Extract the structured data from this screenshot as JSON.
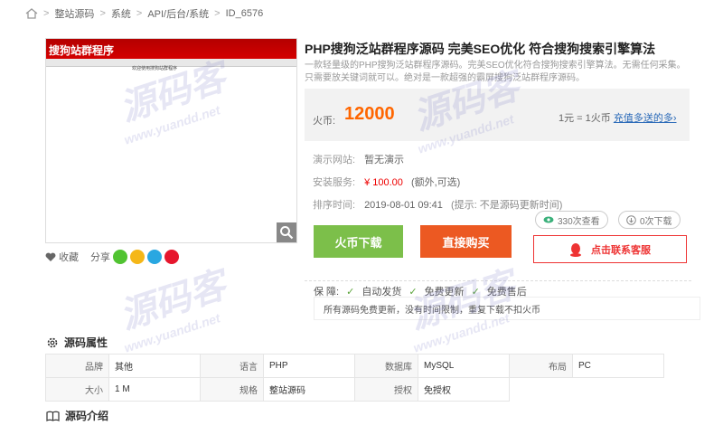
{
  "breadcrumb": {
    "items": [
      "整站源码",
      "系统",
      "API/后台/系统",
      "ID_6576"
    ],
    "sep": ">"
  },
  "preview": {
    "header_text": "搜狗站群程序",
    "mini_text": "欢迎使用搜狗站群程序"
  },
  "actions": {
    "favorite": "收藏",
    "share": "分享"
  },
  "product": {
    "title": "PHP搜狗泛站群程序源码 完美SEO优化 符合搜狗搜索引擎算法",
    "description": "一款轻量级的PHP搜狗泛站群程序源码。完美SEO优化符合搜狗搜索引擎算法。无需任何采集。只需要放关键词就可以。绝对是一款超强的霸屏搜狗泛站群程序源码。"
  },
  "price": {
    "label": "火币:",
    "value": "12000",
    "rate_text": "1元 = 1火币",
    "rate_link": "充值多送的多›"
  },
  "info": {
    "demo_label": "演示网站:",
    "demo_value": "暂无演示",
    "install_label": "安装服务:",
    "install_price": "¥ 100.00",
    "install_note": "(额外,可选)",
    "sort_label": "排序时间:",
    "sort_value": "2019-08-01 09:41",
    "sort_note": "(提示: 不是源码更新时间)",
    "views": "330次查看",
    "downloads": "0次下载"
  },
  "buttons": {
    "download": "火币下载",
    "buy": "直接购买",
    "contact": "点击联系客服"
  },
  "guarantee": {
    "label": "保  障:",
    "items": [
      "自动发货",
      "免费更新",
      "免费售后"
    ],
    "note": "所有源码免费更新，没有时间限制，重复下载不扣火币"
  },
  "attributes": {
    "title": "源码属性",
    "row1": [
      {
        "k": "品牌",
        "v": "其他"
      },
      {
        "k": "语言",
        "v": "PHP"
      },
      {
        "k": "数据库",
        "v": "MySQL"
      },
      {
        "k": "布局",
        "v": "PC"
      }
    ],
    "row2": [
      {
        "k": "大小",
        "v": "1 M"
      },
      {
        "k": "规格",
        "v": "整站源码"
      },
      {
        "k": "授权",
        "v": "免授权"
      }
    ]
  },
  "intro": {
    "title": "源码介绍"
  },
  "watermark": {
    "brand": "源码客",
    "url": "www.yuandd.net"
  },
  "colors": {
    "price": "#ff6600",
    "download_btn": "#7cbf4a",
    "buy_btn": "#ec5922",
    "contact": "#ee3333",
    "link": "#2a6ab8"
  }
}
